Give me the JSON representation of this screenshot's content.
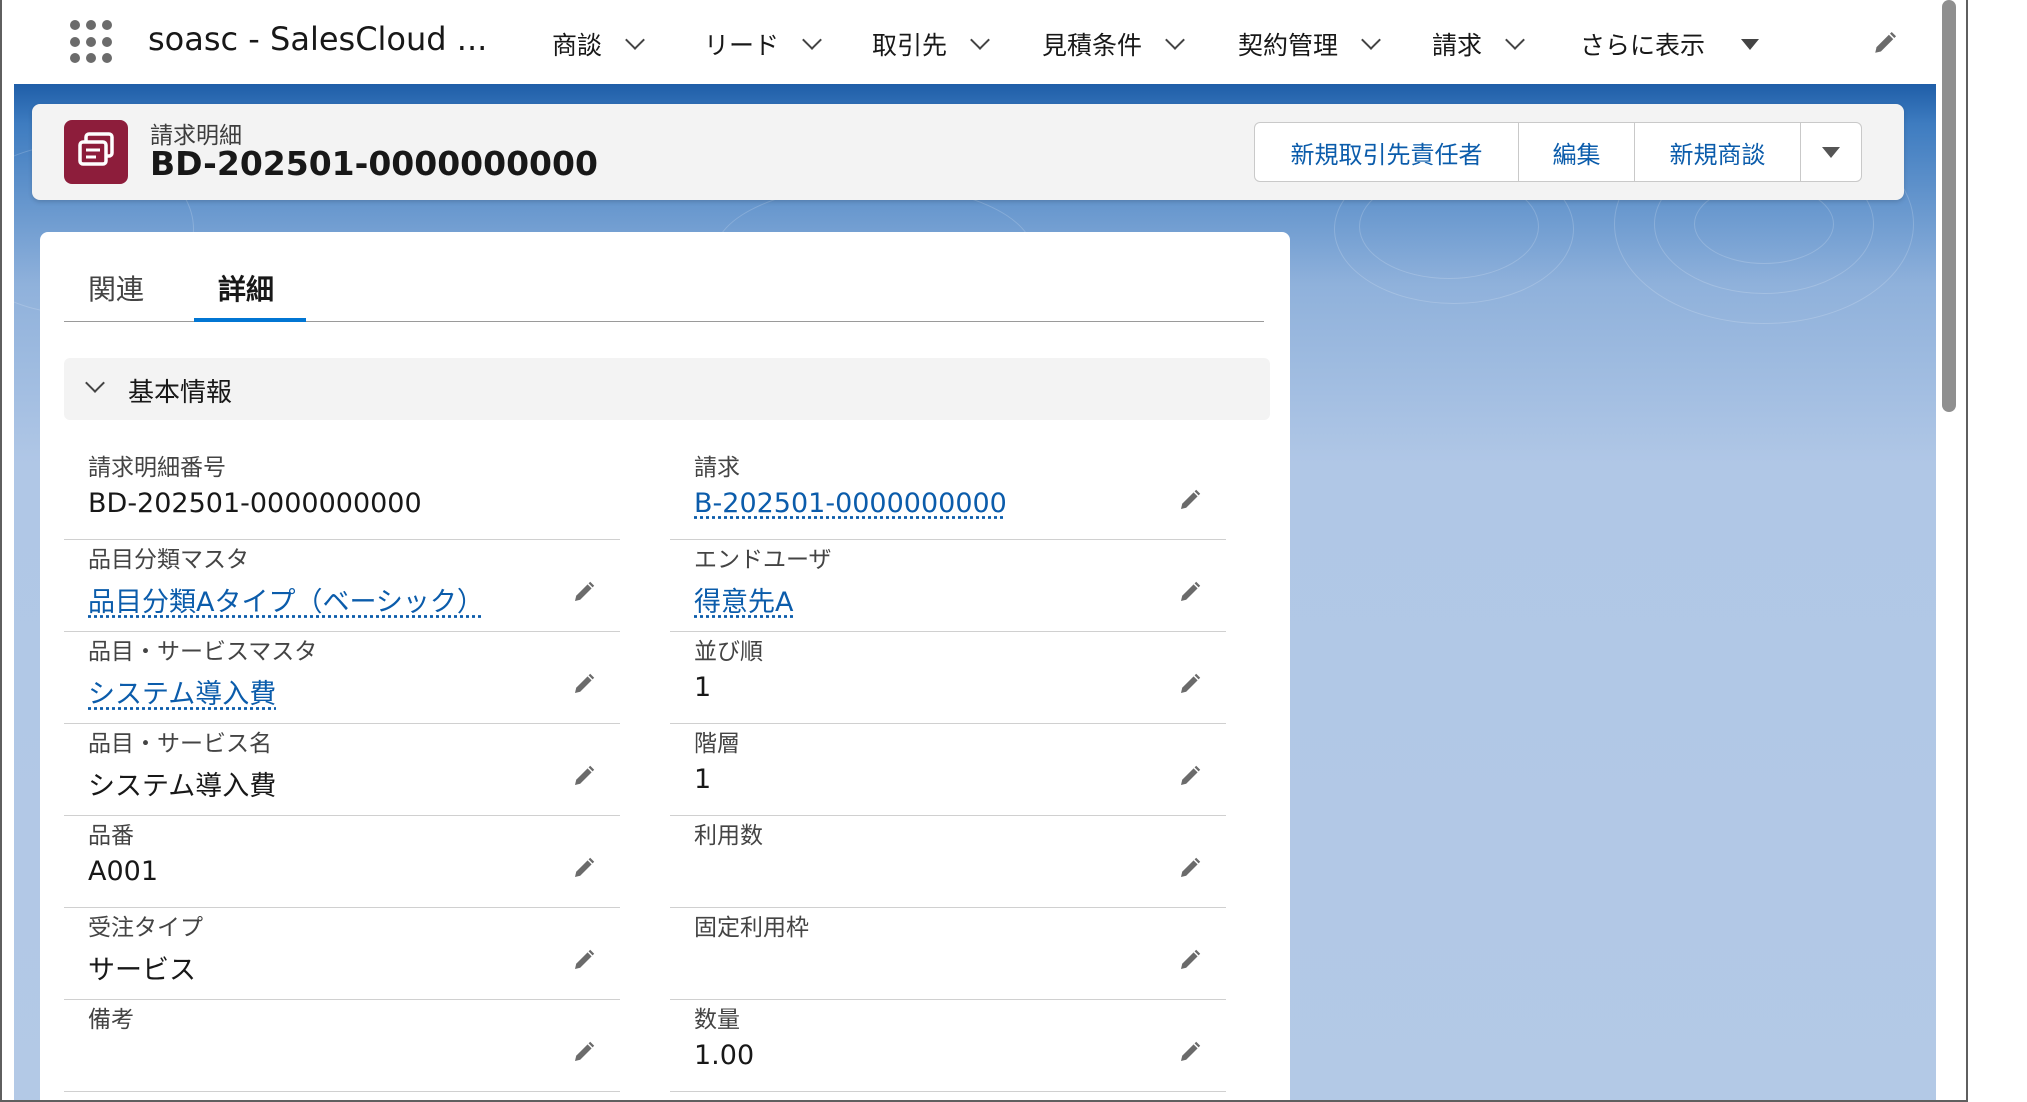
{
  "app": {
    "name": "soasc - SalesCloud ...",
    "nav_items": [
      {
        "label": "商談",
        "caret": "chevron"
      },
      {
        "label": "リード",
        "caret": "chevron"
      },
      {
        "label": "取引先",
        "caret": "chevron"
      },
      {
        "label": "見積条件",
        "caret": "chevron"
      },
      {
        "label": "契約管理",
        "caret": "chevron"
      },
      {
        "label": "請求",
        "caret": "chevron"
      },
      {
        "label": "さらに表示",
        "caret": "triangle"
      }
    ],
    "nav_edit_icon": "pencil-icon"
  },
  "record": {
    "type_label": "請求明細",
    "name": "BD-202501-0000000000",
    "icon": "record-stack-icon",
    "icon_color": "#8d1d3b",
    "actions": [
      "新規取引先責任者",
      "編集",
      "新規商談"
    ],
    "more_actions_icon": "dropdown-triangle-icon"
  },
  "tabs": [
    {
      "label": "関連",
      "active": false
    },
    {
      "label": "詳細",
      "active": true
    }
  ],
  "section": {
    "title": "基本情報",
    "left_fields": [
      {
        "label": "請求明細番号",
        "value": "BD-202501-0000000000",
        "link": false,
        "editable": false
      },
      {
        "label": "品目分類マスタ",
        "value": "品目分類Aタイプ（ベーシック）",
        "link": true,
        "editable": true
      },
      {
        "label": "品目・サービスマスタ",
        "value": "システム導入費",
        "link": true,
        "editable": true
      },
      {
        "label": "品目・サービス名",
        "value": "システム導入費",
        "link": false,
        "editable": true
      },
      {
        "label": "品番",
        "value": "A001",
        "link": false,
        "editable": true
      },
      {
        "label": "受注タイプ",
        "value": "サービス",
        "link": false,
        "editable": true
      },
      {
        "label": "備考",
        "value": "",
        "link": false,
        "editable": true
      }
    ],
    "right_fields": [
      {
        "label": "請求",
        "value": "B-202501-0000000000",
        "link": true,
        "editable": true
      },
      {
        "label": "エンドユーザ",
        "value": "得意先A",
        "link": true,
        "editable": true
      },
      {
        "label": "並び順",
        "value": "1",
        "link": false,
        "editable": true
      },
      {
        "label": "階層",
        "value": "1",
        "link": false,
        "editable": true
      },
      {
        "label": "利用数",
        "value": "",
        "link": false,
        "editable": true
      },
      {
        "label": "固定利用枠",
        "value": "",
        "link": false,
        "editable": true
      },
      {
        "label": "数量",
        "value": "1.00",
        "link": false,
        "editable": true
      }
    ]
  },
  "colors": {
    "link": "#0b5cab",
    "tab_active": "#0176d3",
    "banner": "#3e7cc0"
  }
}
